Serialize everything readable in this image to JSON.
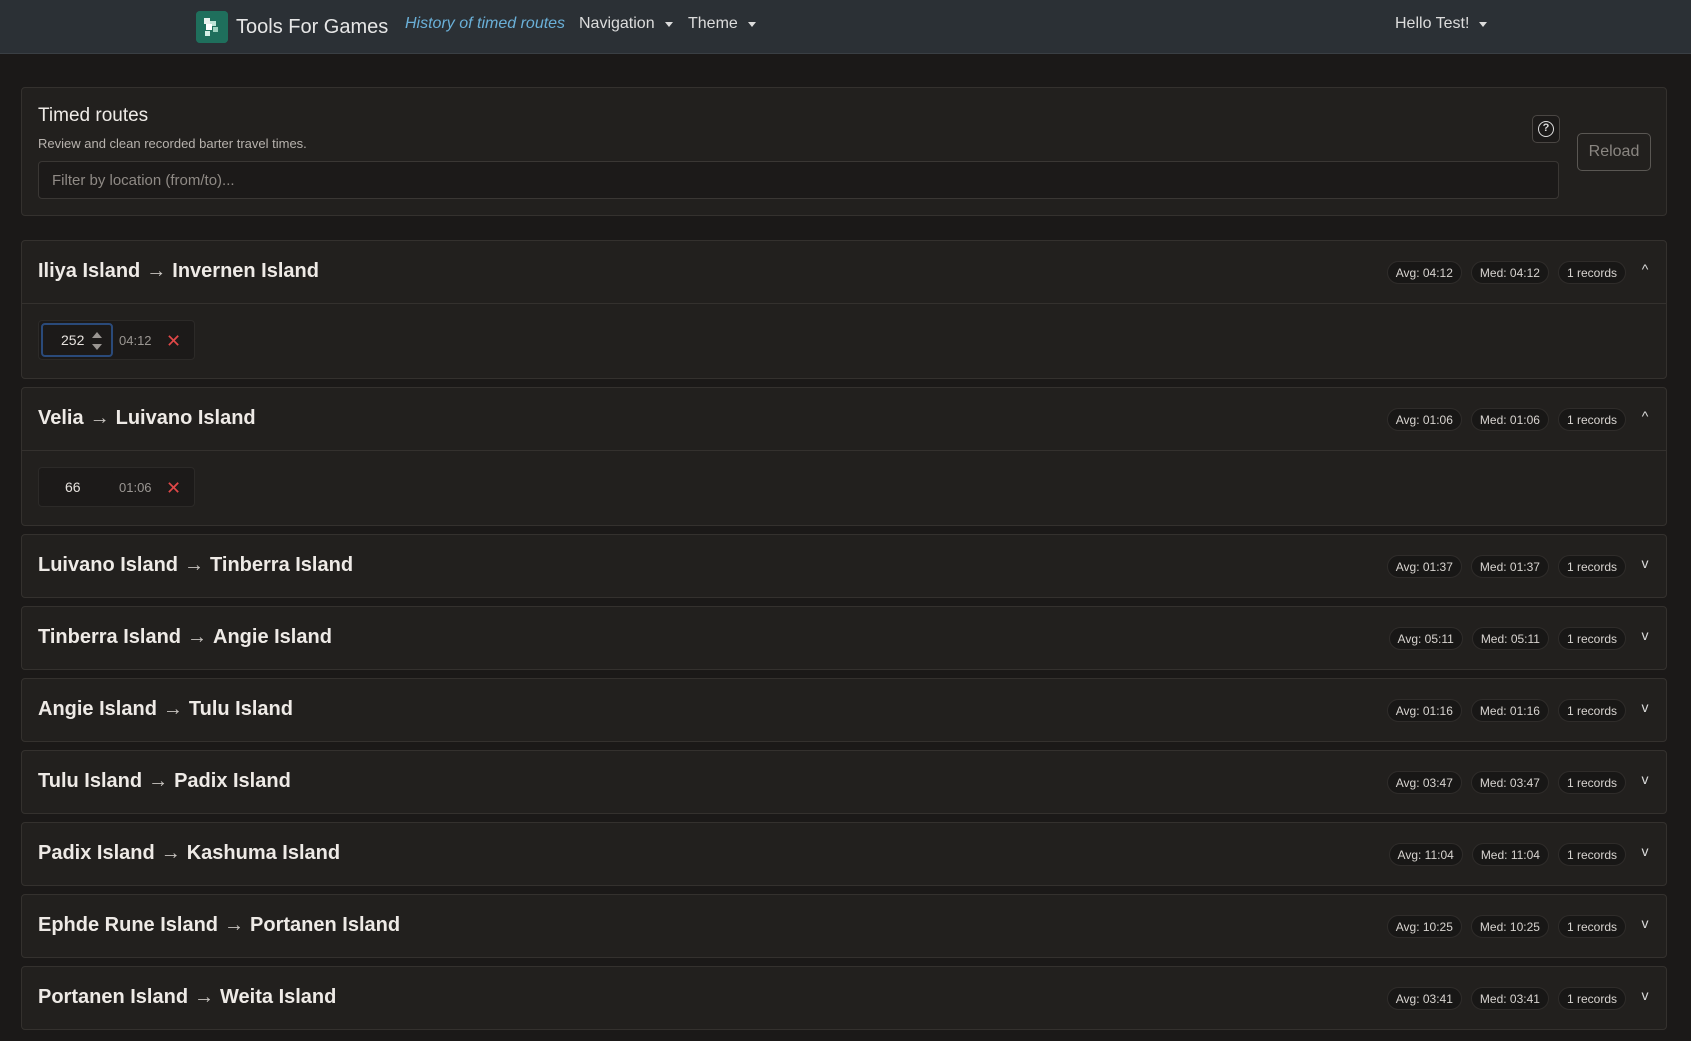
{
  "navbar": {
    "brand": "Tools For Games",
    "links": [
      {
        "label": "History of timed routes",
        "active": true
      },
      {
        "label": "Navigation",
        "dropdown": true
      },
      {
        "label": "Theme",
        "dropdown": true
      }
    ],
    "user": "Hello Test!"
  },
  "header": {
    "title": "Timed routes",
    "subtitle": "Review and clean recorded barter travel times.",
    "filter_placeholder": "Filter by location (from/to)...",
    "reload_label": "Reload",
    "help_icon": "question-circle-icon"
  },
  "routes": [
    {
      "from": "Iliya Island",
      "to": "Invernen Island",
      "avg": "Avg: 04:12",
      "med": "Med: 04:12",
      "count": "1 records",
      "expanded": true,
      "toggle": "^",
      "records": [
        {
          "value": "252",
          "time": "04:12",
          "focused": true
        }
      ]
    },
    {
      "from": "Velia",
      "to": "Luivano Island",
      "avg": "Avg: 01:06",
      "med": "Med: 01:06",
      "count": "1 records",
      "expanded": true,
      "toggle": "^",
      "records": [
        {
          "value": "66",
          "time": "01:06",
          "focused": false
        }
      ]
    },
    {
      "from": "Luivano Island",
      "to": "Tinberra Island",
      "avg": "Avg: 01:37",
      "med": "Med: 01:37",
      "count": "1 records",
      "expanded": false,
      "toggle": "v"
    },
    {
      "from": "Tinberra Island",
      "to": "Angie Island",
      "avg": "Avg: 05:11",
      "med": "Med: 05:11",
      "count": "1 records",
      "expanded": false,
      "toggle": "v"
    },
    {
      "from": "Angie Island",
      "to": "Tulu Island",
      "avg": "Avg: 01:16",
      "med": "Med: 01:16",
      "count": "1 records",
      "expanded": false,
      "toggle": "v"
    },
    {
      "from": "Tulu Island",
      "to": "Padix Island",
      "avg": "Avg: 03:47",
      "med": "Med: 03:47",
      "count": "1 records",
      "expanded": false,
      "toggle": "v"
    },
    {
      "from": "Padix Island",
      "to": "Kashuma Island",
      "avg": "Avg: 11:04",
      "med": "Med: 11:04",
      "count": "1 records",
      "expanded": false,
      "toggle": "v"
    },
    {
      "from": "Ephde Rune Island",
      "to": "Portanen Island",
      "avg": "Avg: 10:25",
      "med": "Med: 10:25",
      "count": "1 records",
      "expanded": false,
      "toggle": "v"
    },
    {
      "from": "Portanen Island",
      "to": "Weita Island",
      "avg": "Avg: 03:41",
      "med": "Med: 03:41",
      "count": "1 records",
      "expanded": false,
      "toggle": "v"
    }
  ],
  "arrow_glyph": "→",
  "delete_glyph": "✕"
}
